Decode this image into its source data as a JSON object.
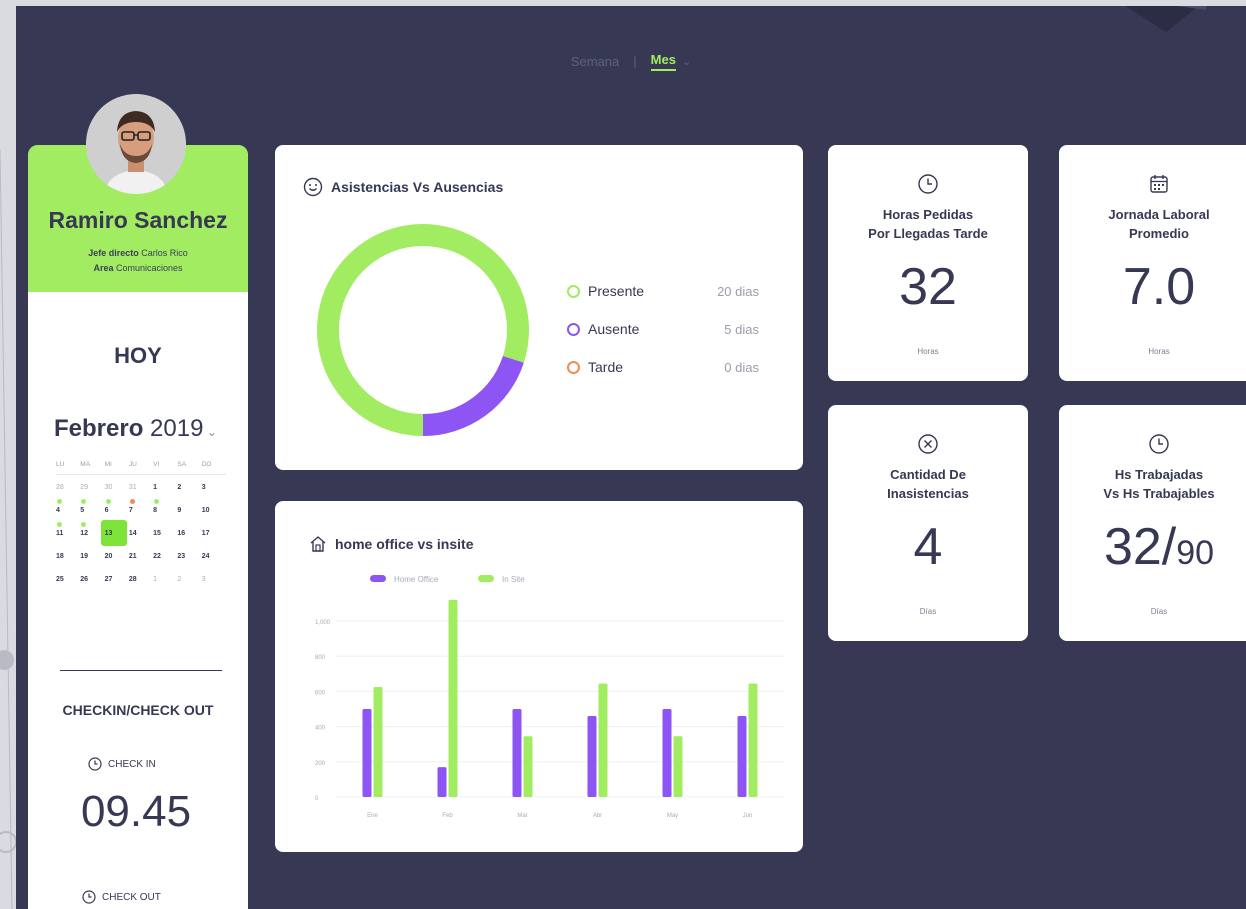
{
  "tabs": {
    "week": "Semana",
    "month": "Mes"
  },
  "profile": {
    "name": "Ramiro Sanchez",
    "boss_label": "Jefe directo",
    "boss": "Carlos Rico",
    "area_label": "Area",
    "area": "Comunicaciones"
  },
  "today": "HOY",
  "calendar": {
    "month": "Febrero",
    "year": "2019",
    "weekdays": [
      "LU",
      "MA",
      "MI",
      "JU",
      "VI",
      "SA",
      "DO"
    ],
    "weeks": [
      [
        {
          "d": "28",
          "m": true
        },
        {
          "d": "29",
          "m": true
        },
        {
          "d": "30",
          "m": true
        },
        {
          "d": "31",
          "m": true
        },
        {
          "d": "1"
        },
        {
          "d": "2"
        },
        {
          "d": "3"
        }
      ],
      [
        {
          "d": "4",
          "dot": "green"
        },
        {
          "d": "5",
          "dot": "green"
        },
        {
          "d": "6",
          "dot": "green"
        },
        {
          "d": "7",
          "dot": "orange"
        },
        {
          "d": "8",
          "dot": "green"
        },
        {
          "d": "9"
        },
        {
          "d": "10"
        }
      ],
      [
        {
          "d": "11",
          "dot": "green"
        },
        {
          "d": "12",
          "dot": "green"
        },
        {
          "d": "13",
          "sel": true
        },
        {
          "d": "14"
        },
        {
          "d": "15"
        },
        {
          "d": "16"
        },
        {
          "d": "17"
        }
      ],
      [
        {
          "d": "18"
        },
        {
          "d": "19"
        },
        {
          "d": "20"
        },
        {
          "d": "21"
        },
        {
          "d": "22"
        },
        {
          "d": "23"
        },
        {
          "d": "24"
        }
      ],
      [
        {
          "d": "25"
        },
        {
          "d": "26"
        },
        {
          "d": "27"
        },
        {
          "d": "28"
        },
        {
          "d": "1",
          "m": true
        },
        {
          "d": "2",
          "m": true
        },
        {
          "d": "3",
          "m": true
        }
      ]
    ]
  },
  "checkin": {
    "title": "CHECKIN/CHECK OUT",
    "in_label": "CHECK IN",
    "in_time": "09.45",
    "out_label": "CHECK OUT"
  },
  "attendance": {
    "title": "Asistencias Vs Ausencias",
    "items": [
      {
        "label": "Presente",
        "value": "20 dias",
        "color": "#a2ec62"
      },
      {
        "label": "Ausente",
        "value": "5 dias",
        "color": "#8e55f5"
      },
      {
        "label": "Tarde",
        "value": "0 dias",
        "color": "#f28b55"
      }
    ]
  },
  "stats": [
    {
      "title_1": "Horas Pedidas",
      "title_2": "Por Llegadas Tarde",
      "value": "32",
      "unit": "Horas",
      "icon": "clock-icon"
    },
    {
      "title_1": "Jornada Laboral",
      "title_2": "Promedio",
      "value": "7.0",
      "unit": "Horas",
      "icon": "calendar-icon"
    },
    {
      "title_1": "Cantidad De",
      "title_2": "Inasistencias",
      "value": "4",
      "unit": "Días",
      "icon": "cancel-icon"
    },
    {
      "title_1": "Hs Trabajadas",
      "title_2": "Vs Hs Trabajables",
      "value": "32/",
      "value_small": "90",
      "unit": "Días",
      "icon": "clock-icon"
    }
  ],
  "colors": {
    "green": "#a2ec62",
    "purple": "#8e55f5",
    "orange": "#f28b55",
    "navy": "#363854"
  },
  "chart_data": [
    {
      "type": "pie",
      "categories": [
        "Presente",
        "Ausente",
        "Tarde"
      ],
      "values": [
        20,
        5,
        0
      ],
      "title": "Asistencias Vs Ausencias"
    },
    {
      "type": "bar",
      "title": "home office vs insite",
      "categories": [
        "Ene",
        "Feb",
        "Mar",
        "Abr",
        "May",
        "Jun"
      ],
      "series": [
        {
          "name": "Home Office",
          "values": [
            500,
            170,
            500,
            460,
            500,
            460
          ],
          "color": "#8e55f5"
        },
        {
          "name": "In Site",
          "values": [
            625,
            1120,
            345,
            645,
            345,
            645
          ],
          "color": "#a2ec62"
        }
      ],
      "yticks": [
        "0",
        "200",
        "400",
        "600",
        "800",
        "1,000"
      ],
      "ylim": [
        0,
        1000
      ],
      "xlabel": "",
      "ylabel": ""
    }
  ]
}
